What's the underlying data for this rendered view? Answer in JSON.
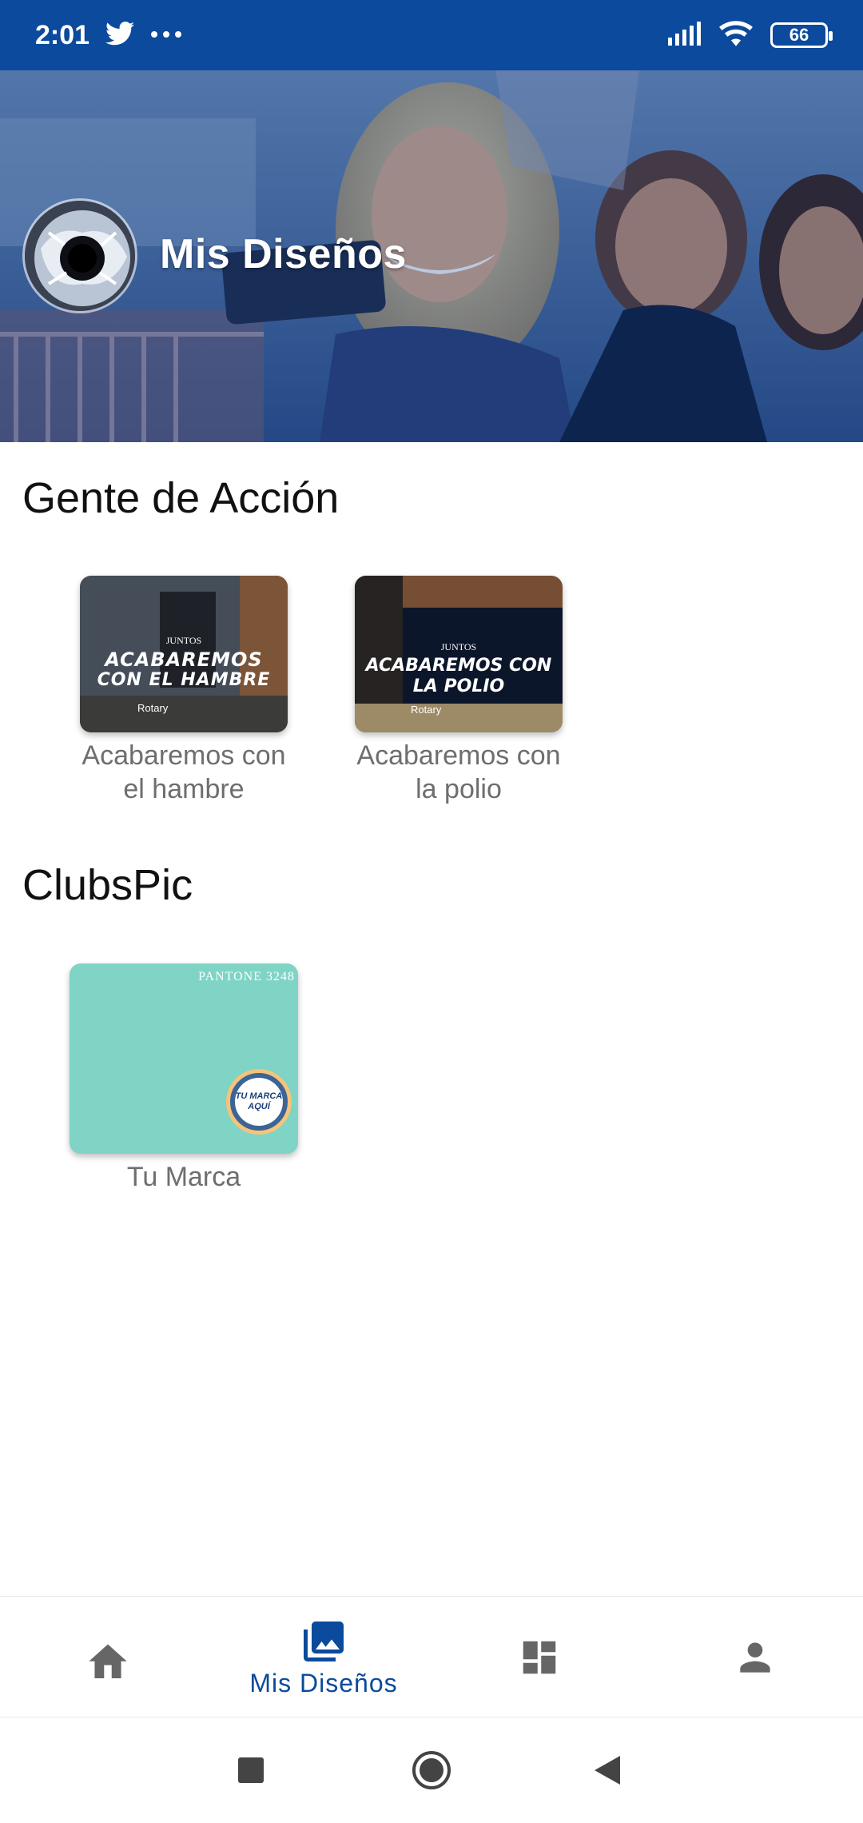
{
  "status_bar": {
    "time": "2:01",
    "battery": "66",
    "icons": [
      "twitter-icon",
      "more-dots-icon",
      "signal-icon",
      "wifi-icon",
      "battery-icon"
    ]
  },
  "header": {
    "title": "Mis Diseños"
  },
  "sections": [
    {
      "title": "Gente de Acción",
      "items": [
        {
          "label_line1": "Acabaremos con",
          "label_line2": "el hambre",
          "thumb_small": "JUNTOS",
          "thumb_main_1": "ACABAREMOS",
          "thumb_main_2": "CON EL HAMBRE",
          "thumb_footer": "Rotary"
        },
        {
          "label_line1": "Acabaremos con",
          "label_line2": "la polio",
          "thumb_small": "JUNTOS",
          "thumb_main_1": "ACABAREMOS CON",
          "thumb_main_2": "LA POLIO",
          "thumb_footer": "Rotary"
        }
      ]
    },
    {
      "title": "ClubsPic",
      "items": [
        {
          "label_line1": "Tu Marca",
          "thumb_corner": "PANTONE 3248",
          "thumb_badge_1": "TU MARCA",
          "thumb_badge_2": "AQUÍ"
        }
      ]
    }
  ],
  "bottom_nav": {
    "items": [
      {
        "icon": "home-icon",
        "label": ""
      },
      {
        "icon": "photo-library-icon",
        "label": "Mis Diseños"
      },
      {
        "icon": "dashboard-icon",
        "label": ""
      },
      {
        "icon": "person-icon",
        "label": ""
      }
    ],
    "active_index": 1
  },
  "system_nav": {
    "icons": [
      "recents-square-icon",
      "home-circle-icon",
      "back-triangle-icon"
    ]
  },
  "colors": {
    "brand": "#0b4a9c",
    "nav_inactive": "#666666",
    "tile_teal": "#7fd4c5"
  }
}
